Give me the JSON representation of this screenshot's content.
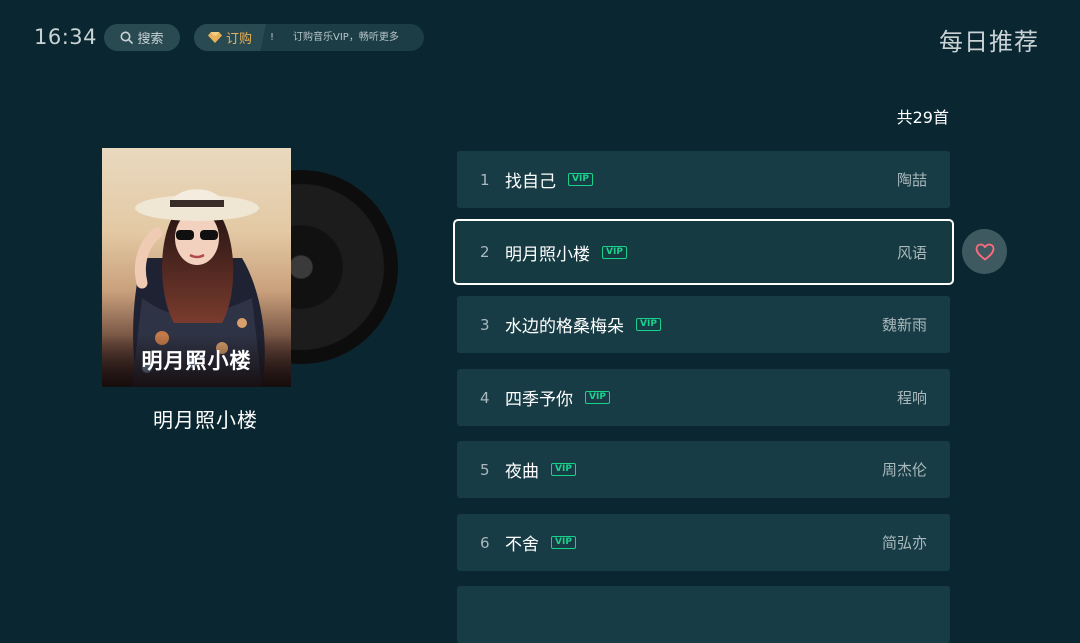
{
  "header": {
    "time": "16:34",
    "search_label": "搜索",
    "subscribe_label": "订购",
    "subscribe_mark": "!",
    "subscribe_tip": "订购音乐VIP，畅听更多",
    "page_title": "每日推荐"
  },
  "list_info": {
    "count_label": "共29首"
  },
  "album": {
    "cover_title": "明月照小楼",
    "name": "明月照小楼"
  },
  "vip_badge": "VIP",
  "songs": [
    {
      "index": "1",
      "title": "找自己",
      "artist": "陶喆"
    },
    {
      "index": "2",
      "title": "明月照小楼",
      "artist": "风语"
    },
    {
      "index": "3",
      "title": "水边的格桑梅朵",
      "artist": "魏新雨"
    },
    {
      "index": "4",
      "title": "四季予你",
      "artist": "程响"
    },
    {
      "index": "5",
      "title": "夜曲",
      "artist": "周杰伦"
    },
    {
      "index": "6",
      "title": "不舍",
      "artist": "简弘亦"
    }
  ],
  "icons": {
    "search": "search-icon",
    "vip": "diamond-icon",
    "favorite": "heart-icon",
    "disc": "vinyl-disc"
  },
  "colors": {
    "background": "#0a2630",
    "row": "#173c45",
    "vip_green": "#1ad18c",
    "vip_gold": "#e8b25a",
    "heart": "#ff6b7e"
  }
}
